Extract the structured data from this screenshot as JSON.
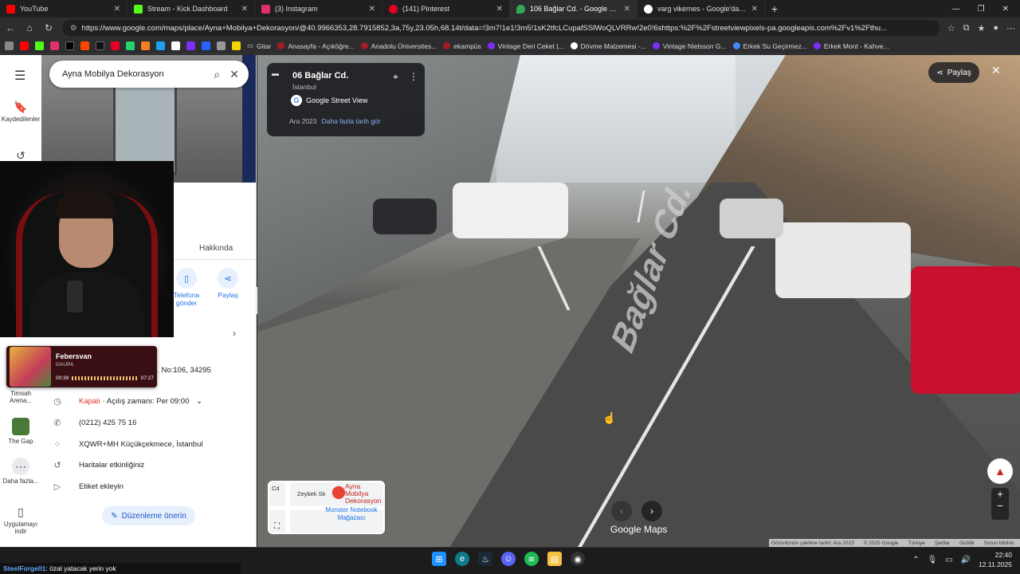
{
  "browser": {
    "tabs": [
      {
        "title": "YouTube",
        "color": "#ff0000",
        "active": false
      },
      {
        "title": "Stream - Kick Dashboard",
        "color": "#53fc18",
        "active": false
      },
      {
        "title": "(3) Instagram",
        "color": "#e1306c",
        "active": false
      },
      {
        "title": "(141) Pinterest",
        "color": "#e60023",
        "active": false
      },
      {
        "title": "106 Bağlar Cd. - Google Haritalar",
        "color": "#34a853",
        "active": true
      },
      {
        "title": "varg vikernes - Google'da Ara",
        "color": "#4285f4",
        "active": false
      }
    ],
    "url": "https://www.google.com/maps/place/Ayna+Mobilya+Dekorasyon/@40.9966353,28.7915852,3a,75y,23.05h,68.14t/data=!3m7!1e1!3m5!1sK2tfcLCupafSSlWoQLVRRw!2e0!6shttps:%2F%2Fstreetviewpixels-pa.googleapis.com%2Fv1%2Fthu...",
    "bookmarks": [
      "Gitar",
      "Anasayfa - Açıköğre...",
      "Anadolu Üniversites...",
      "ekampüs",
      "Vintage Deri Ceket |...",
      "Dövme Malzemesi -...",
      "Vintage Nielsson G...",
      "Erkek Su Geçirmez...",
      "Erkek Mont - Kahve..."
    ]
  },
  "maps": {
    "search_query": "Ayna Mobilya Dekorasyon",
    "rail": {
      "saved": "Kaydedilenler",
      "timsah": "Timsah Arena...",
      "thegap": "The Gap",
      "more": "Daha fazla...",
      "app": "Uygulamayı indir"
    },
    "place_title_partial": "ron",
    "tab_about": "Hakkında",
    "action_phone": "Telefona gönder",
    "action_share": "Paylaş",
    "address_partial": "Sultançiftliği, Bağlar Cd. No:106, 34295",
    "hours_status": "Kapalı",
    "hours_text": " · Açılış zamanı: Per 09:00",
    "phone": "(0212) 425 75 16",
    "plus_code": "XQWR+MH Küçükçekmece, İstanbul",
    "activity": "Haritalar etkinliğiniz",
    "label": "Etiket ekleyin",
    "suggest_edit": "Düzenleme önerin"
  },
  "streetview": {
    "card_title": "06 Bağlar Cd.",
    "card_city": "İstanbul",
    "brand": "Google Street View",
    "date": "Ara 2023",
    "more_dates": "Daha fazla tarih gör",
    "share": "Paylaş",
    "road_text": "Bağlar Cd.",
    "minimap_business": "Ayna Mobilya Dekorasyon",
    "minimap_shop": "Monster Notebook Mağazası",
    "minimap_street": "Zeybek Sk",
    "minimap_cd": "Cd",
    "google_maps": "Google Maps",
    "footer": [
      "Görüntünün çekilme tarihi: Ara 2023",
      "© 2025 Google",
      "Türkiye",
      "Şartlar",
      "Gizlilik",
      "Sorun bildirin"
    ]
  },
  "music": {
    "song": "Febersvan",
    "artist": "GAUPA",
    "elapsed": "00:39",
    "total": "07:27"
  },
  "chat": {
    "user": "SteelForge01",
    "message": ": özal yatacak yerin yok"
  },
  "taskbar": {
    "time": "22:40",
    "date": "12.11.2025"
  }
}
